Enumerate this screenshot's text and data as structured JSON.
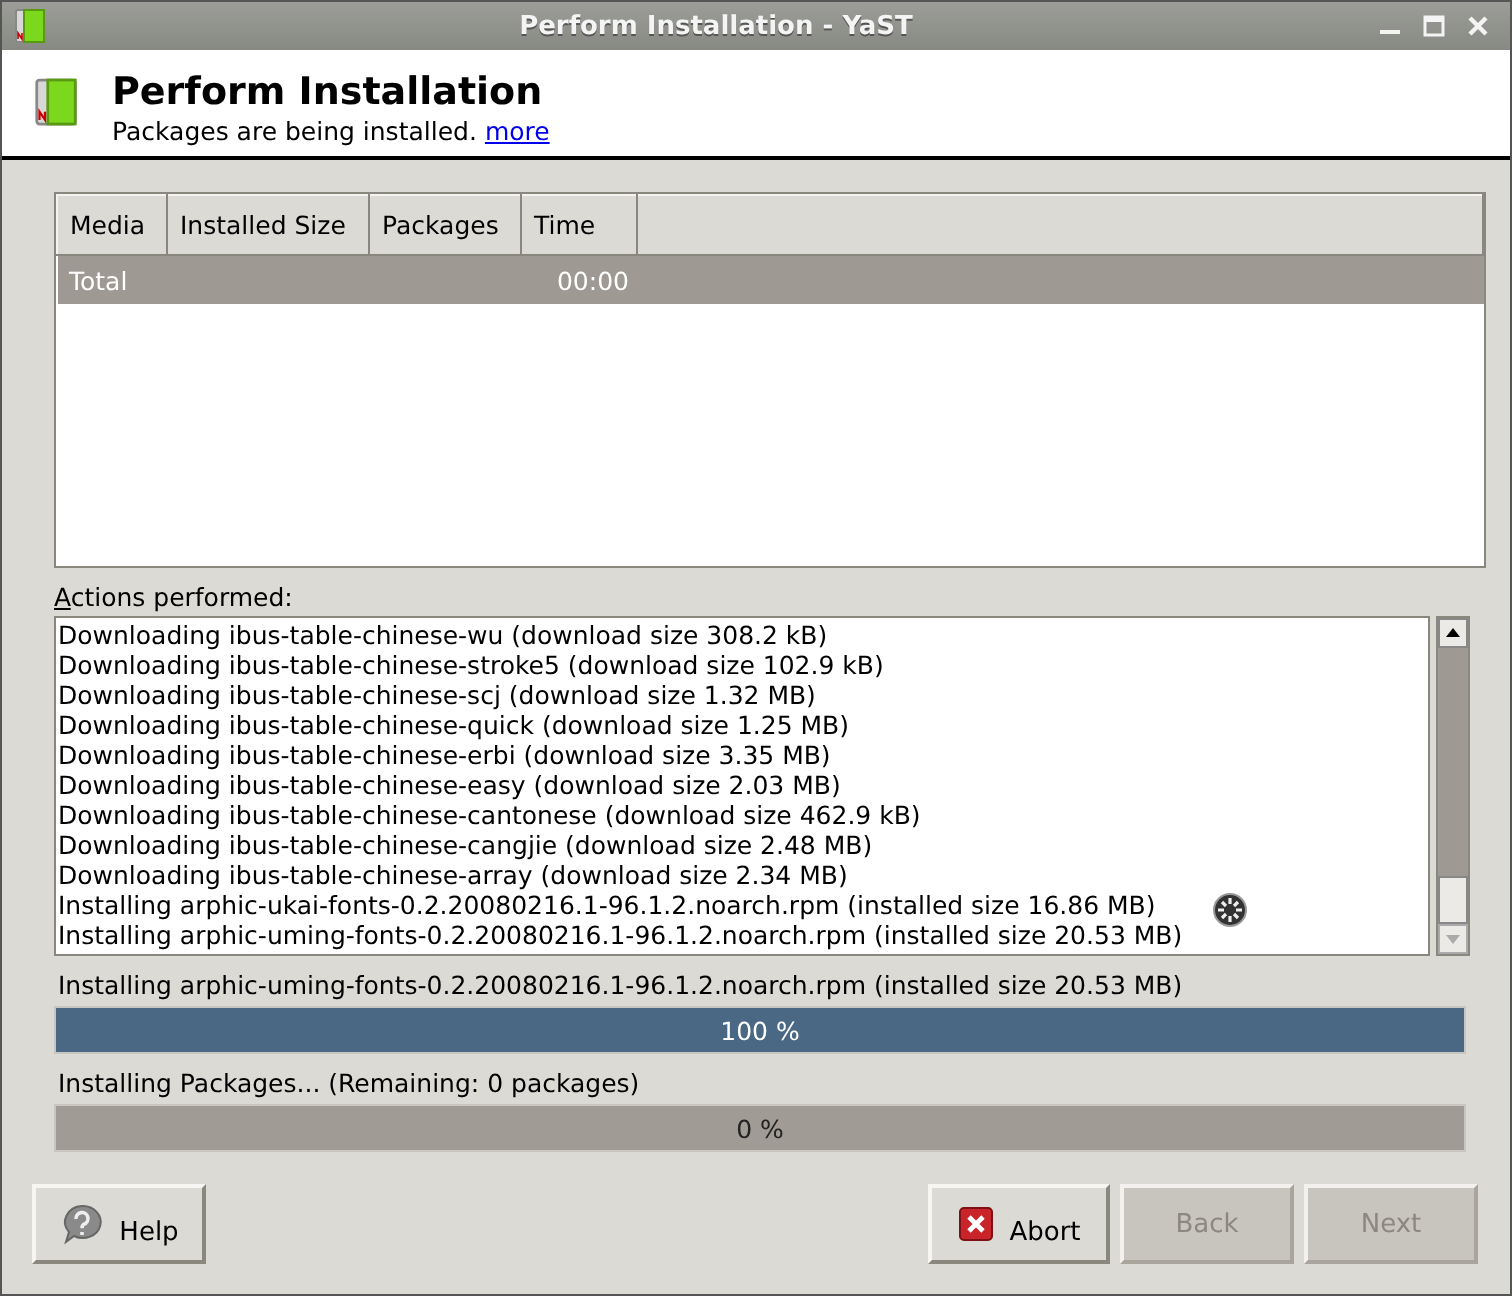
{
  "window": {
    "title": "Perform Installation - YaST"
  },
  "header": {
    "title": "Perform Installation",
    "subtitle": "Packages are being installed.",
    "link": "more"
  },
  "table": {
    "columns": [
      "Media",
      "Installed Size",
      "Packages",
      "Time"
    ],
    "rows": [
      {
        "media": "Total",
        "time": "00:00",
        "selected": true
      }
    ]
  },
  "log": {
    "label": "Actions performed:",
    "lines": [
      "Downloading ibus-table-chinese-wu (download size 308.2 kB)",
      "Downloading ibus-table-chinese-stroke5 (download size 102.9 kB)",
      "Downloading ibus-table-chinese-scj (download size 1.32 MB)",
      "Downloading ibus-table-chinese-quick (download size 1.25 MB)",
      "Downloading ibus-table-chinese-erbi (download size 3.35 MB)",
      "Downloading ibus-table-chinese-easy (download size 2.03 MB)",
      "Downloading ibus-table-chinese-cantonese (download size 462.9 kB)",
      "Downloading ibus-table-chinese-cangjie (download size 2.48 MB)",
      "Downloading ibus-table-chinese-array (download size 2.34 MB)",
      "Installing arphic-ukai-fonts-0.2.20080216.1-96.1.2.noarch.rpm (installed size 16.86 MB)",
      "Installing arphic-uming-fonts-0.2.20080216.1-96.1.2.noarch.rpm (installed size 20.53 MB)"
    ]
  },
  "progress": [
    {
      "label": "Installing arphic-uming-fonts-0.2.20080216.1-96.1.2.noarch.rpm (installed size 20.53 MB)",
      "level": 1,
      "reading": "100 %"
    },
    {
      "label": "Installing Packages... (Remaining: 0 packages)",
      "level": 0,
      "reading": "0 %"
    }
  ],
  "buttons": [
    {
      "label": "Help",
      "kind": "help",
      "disabled": false
    },
    {
      "label": "Abort",
      "kind": "abort",
      "disabled": false
    },
    {
      "label": "Back",
      "kind": "plain",
      "disabled": true
    },
    {
      "label": "Next",
      "kind": "plain",
      "disabled": true
    }
  ]
}
